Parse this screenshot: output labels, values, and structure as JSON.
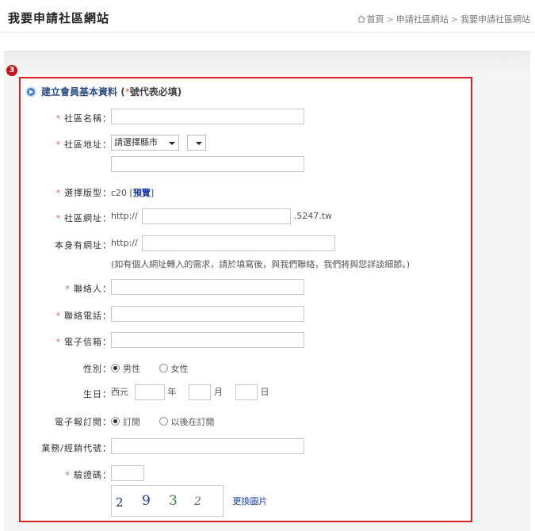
{
  "header": {
    "title": "我要申請社區網站",
    "breadcrumb": [
      "首頁",
      "申請社區網站",
      "我要申請社區網站"
    ],
    "separator": ">"
  },
  "step": {
    "number": "3"
  },
  "section": {
    "title": "建立會員基本資料",
    "note_open": "(",
    "note_star": "*",
    "note_text": "號代表必填)"
  },
  "required_mark": "*",
  "fields": {
    "community_name": {
      "label": "社區名稱：",
      "value": ""
    },
    "community_address": {
      "label": "社區地址：",
      "county_select": "請選擇縣市",
      "district_select": "",
      "detail_value": ""
    },
    "template": {
      "label": "選擇版型：",
      "value": "c20",
      "bracket_open": "[",
      "preview_link": "預覽",
      "bracket_close": "]"
    },
    "community_url": {
      "label": "社區網址：",
      "prefix": "http://",
      "value": "",
      "suffix": ".5247.tw"
    },
    "own_url": {
      "label": "本身有網址：",
      "prefix": "http://",
      "value": "",
      "hint": "(如有個人網址轉入的需求，請於填寫後，與我們聯絡，我們將與您詳談細節。)"
    },
    "contact_person": {
      "label": "聯絡人：",
      "value": ""
    },
    "contact_phone": {
      "label": "聯絡電話：",
      "value": ""
    },
    "email": {
      "label": "電子信箱：",
      "value": ""
    },
    "gender": {
      "label": "性別：",
      "options": [
        "男性",
        "女性"
      ],
      "selected": "男性"
    },
    "birthday": {
      "label": "生日：",
      "era": "西元",
      "year_unit": "年",
      "month_unit": "月",
      "day_unit": "日",
      "year": "",
      "month": "",
      "day": ""
    },
    "newsletter": {
      "label": "電子報訂閱：",
      "options": [
        "訂閱",
        "以後在訂閱"
      ],
      "selected": "訂閱"
    },
    "agent_code": {
      "label": "業務/經銷代號：",
      "value": ""
    },
    "captcha": {
      "label": "驗證碼：",
      "value": "",
      "digits": [
        "2",
        "9",
        "3",
        "2"
      ],
      "digit_colors": [
        "#1a2a6a",
        "#1a3fb0",
        "#2f8f3f",
        "#666666"
      ],
      "refresh_link": "更換圖片"
    }
  },
  "colors": {
    "accent_red": "#e02020",
    "link_blue": "#1a3fb0",
    "required_orange": "#e06040"
  }
}
